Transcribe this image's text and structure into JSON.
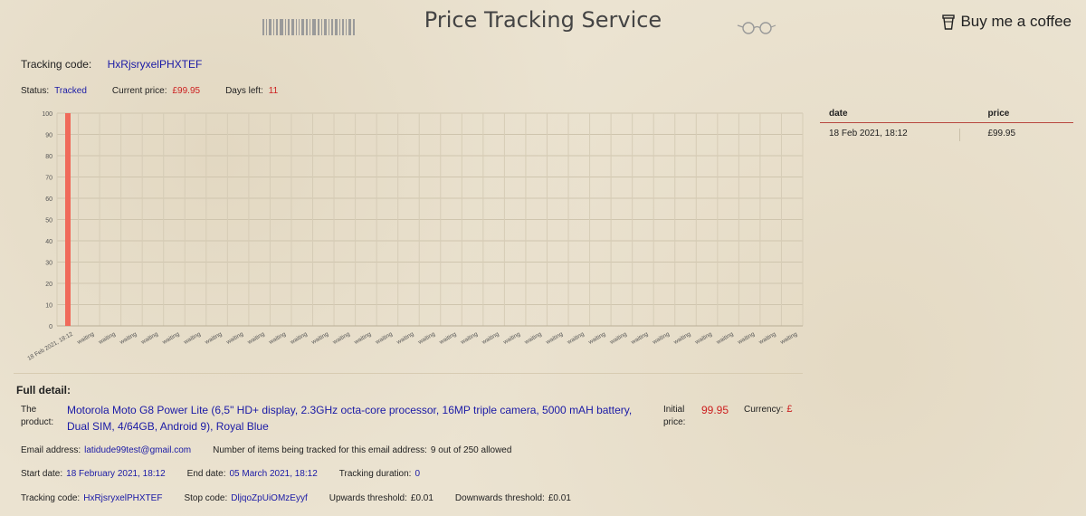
{
  "header": {
    "title": "Price Tracking Service",
    "coffee_label": "Buy me a coffee"
  },
  "tracking": {
    "code_label": "Tracking code:",
    "code": "HxRjsryxelPHXTEF"
  },
  "status": {
    "status_label": "Status:",
    "status_value": "Tracked",
    "price_label": "Current price:",
    "price_value": "£99.95",
    "days_label": "Days left:",
    "days_value": "11"
  },
  "chart_data": {
    "type": "bar",
    "ylim": [
      0,
      100
    ],
    "yticks": [
      0,
      10,
      20,
      30,
      40,
      50,
      60,
      70,
      80,
      90,
      100
    ],
    "categories": [
      "18 Feb 2021, 18:12",
      "waiting",
      "waiting",
      "waiting",
      "waiting",
      "waiting",
      "waiting",
      "waiting",
      "waiting",
      "waiting",
      "waiting",
      "waiting",
      "waiting",
      "waiting",
      "waiting",
      "waiting",
      "waiting",
      "waiting",
      "waiting",
      "waiting",
      "waiting",
      "waiting",
      "waiting",
      "waiting",
      "waiting",
      "waiting",
      "waiting",
      "waiting",
      "waiting",
      "waiting",
      "waiting",
      "waiting",
      "waiting",
      "waiting",
      "waiting"
    ],
    "values": [
      100
    ],
    "bar_color": "#f06a5a",
    "grid": true
  },
  "history": {
    "headers": [
      "date",
      "price"
    ],
    "rows": [
      [
        "18 Feb 2021, 18:12",
        "£99.95"
      ]
    ]
  },
  "detail": {
    "title": "Full detail:",
    "product_label": "The product:",
    "product_name": "Motorola Moto G8 Power Lite (6,5\" HD+ display, 2.3GHz octa-core processor, 16MP triple camera, 5000 mAH battery, Dual SIM, 4/64GB, Android 9), Royal Blue",
    "initial_price_label": "Initial price:",
    "initial_price": "99.95",
    "currency_label": "Currency:",
    "currency": "£",
    "email_label": "Email address:",
    "email": "latidude99test@gmail.com",
    "items_label": "Number of items being tracked for this email address:",
    "items_value": "9 out of 250 allowed",
    "start_label": "Start date:",
    "start_value": "18 February 2021, 18:12",
    "end_label": "End date:",
    "end_value": "05 March 2021, 18:12",
    "duration_label": "Tracking duration:",
    "duration_value": "0",
    "tcode_label": "Tracking code:",
    "tcode_value": "HxRjsryxelPHXTEF",
    "stop_label": "Stop code:",
    "stop_value": "DljqoZpUiOMzEyyf",
    "up_label": "Upwards threshold:",
    "up_value": "£0.01",
    "down_label": "Downwards threshold:",
    "down_value": "£0.01"
  }
}
